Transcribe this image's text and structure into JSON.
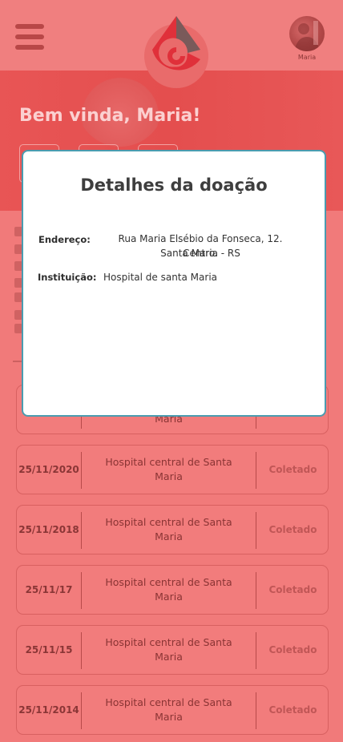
{
  "header": {
    "avatar_name": "Maria",
    "colors": {
      "topbar": "#F07F7F",
      "accent": "#E44E4E",
      "modal_border": "#4A9CB0"
    },
    "icons": [
      "menu-icon",
      "blood-drop-logo",
      "user-avatar"
    ]
  },
  "hero": {
    "welcome": "Bem vinda, Maria!"
  },
  "modal": {
    "title": "Detalhes da doação",
    "address_label": "Endereço:",
    "address_line1": "Rua Maria Elsébio da Fonseca, 12. Centro.",
    "address_line2": "Santa Maria -  RS",
    "institution_label": "Instituição:",
    "institution_value": "Hospital de santa Maria"
  },
  "donations": [
    {
      "date": "",
      "institution_tail": "Maria",
      "status": ""
    },
    {
      "date": "25/11/2020",
      "institution": "Hospital central de Santa Maria",
      "status": "Coletado"
    },
    {
      "date": "25/11/2018",
      "institution": "Hospital central de Santa Maria",
      "status": "Coletado"
    },
    {
      "date": "25/11/17",
      "institution": "Hospital central de Santa Maria",
      "status": "Coletado"
    },
    {
      "date": "25/11/15",
      "institution": "Hospital central de Santa Maria",
      "status": "Coletado"
    },
    {
      "date": "25/11/2014",
      "institution": "Hospital central de Santa Maria",
      "status": "Coletado"
    }
  ]
}
